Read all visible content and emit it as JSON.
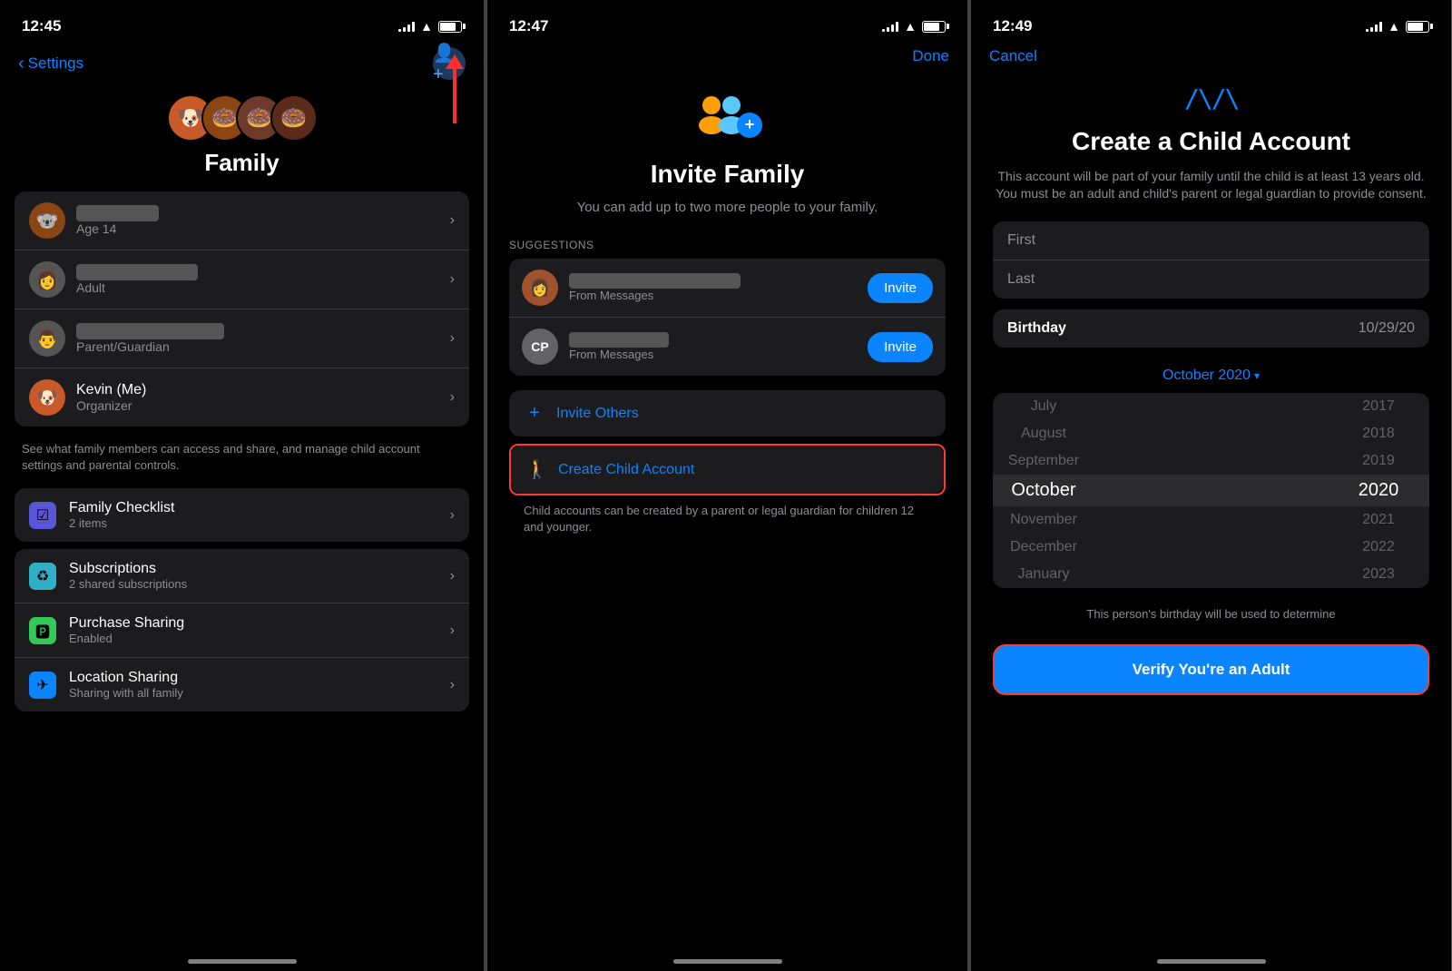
{
  "screen1": {
    "time": "12:45",
    "nav": {
      "back_label": "Settings"
    },
    "title": "Family",
    "members": [
      {
        "name": "████████",
        "sub": "Age 14",
        "avatar": "🐻"
      },
      {
        "name": "███ ████ ████",
        "sub": "Adult",
        "avatar": "👩"
      },
      {
        "name": "████████ ██████",
        "sub": "Parent/Guardian",
        "avatar": "👨"
      },
      {
        "name": "Kevin (Me)",
        "sub": "Organizer",
        "avatar": "🐶"
      }
    ],
    "description": "See what family members can access and share, and manage child account settings and parental controls.",
    "features": [
      {
        "icon": "🟪",
        "icon_bg": "#5856d6",
        "title": "Family Checklist",
        "sub": "2 items"
      },
      {
        "icon": "🔵",
        "icon_bg": "#30b0c7",
        "title": "Subscriptions",
        "sub": "2 shared subscriptions"
      },
      {
        "icon": "🟢",
        "icon_bg": "#34c759",
        "title": "Purchase Sharing",
        "sub": "Enabled"
      },
      {
        "icon": "🔵",
        "icon_bg": "#0a84ff",
        "title": "Location Sharing",
        "sub": "Sharing with all family"
      }
    ]
  },
  "screen2": {
    "time": "12:47",
    "nav": {
      "done_label": "Done"
    },
    "title": "Invite Family",
    "subtitle": "You can add up to two more people to your family.",
    "suggestions_label": "SUGGESTIONS",
    "suggestions": [
      {
        "initials": "",
        "name": "███ ████████ ██████",
        "from": "From Messages"
      },
      {
        "initials": "CP",
        "name": "████ ██████",
        "from": "From Messages"
      }
    ],
    "invite_btn_label": "Invite",
    "actions": [
      {
        "icon": "+",
        "label": "Invite Others"
      },
      {
        "icon": "🚶",
        "label": "Create Child Account"
      }
    ],
    "child_note": "Child accounts can be created by a parent or legal guardian for children 12 and younger."
  },
  "screen3": {
    "time": "12:49",
    "nav": {
      "cancel_label": "Cancel"
    },
    "logo": "⌃⌄",
    "title": "Create a Child Account",
    "description": "This account will be part of your family until the child is at least 13 years old. You must be an adult and child's parent or legal guardian to provide consent.",
    "form": {
      "first_name_placeholder": "First",
      "last_name_placeholder": "Last",
      "birthday_label": "Birthday",
      "birthday_value": "10/29/20"
    },
    "month_selector": "October 2020",
    "picker_rows": [
      {
        "month": "July",
        "year": "2017"
      },
      {
        "month": "August",
        "year": "2018"
      },
      {
        "month": "September",
        "year": "2019"
      },
      {
        "month": "October",
        "year": "2020",
        "selected": true
      },
      {
        "month": "November",
        "year": "2021"
      },
      {
        "month": "December",
        "year": "2022"
      },
      {
        "month": "January",
        "year": "2023"
      }
    ],
    "bottom_note": "This person's birthday will be used to determine",
    "verify_btn": "Verify You're an Adult"
  }
}
